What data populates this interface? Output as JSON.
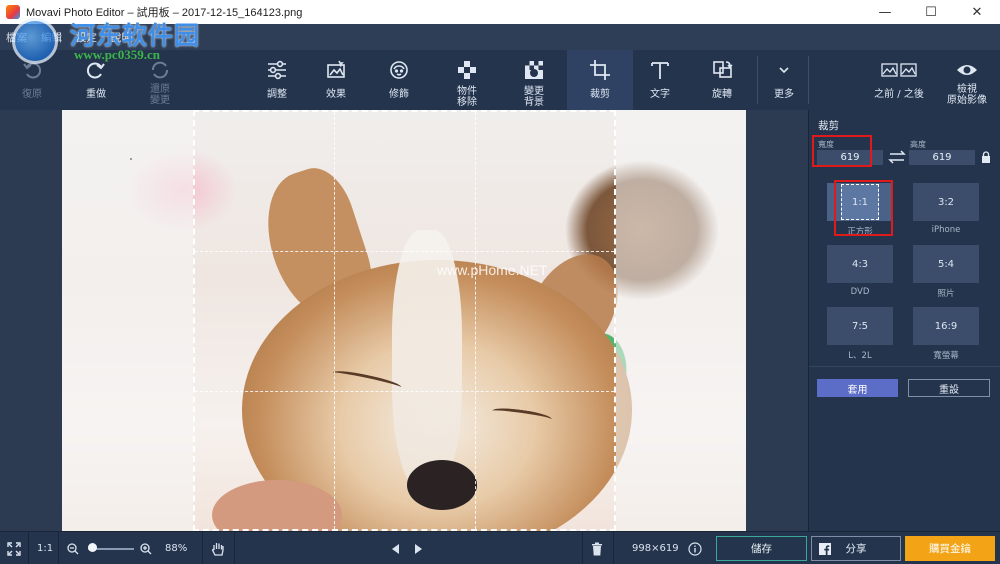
{
  "window": {
    "title": "Movavi Photo Editor – 試用板 – 2017-12-15_164123.png",
    "controls": {
      "minimize": "—",
      "maximize": "☐",
      "close": "✕"
    }
  },
  "menu": [
    "檔案",
    "編輯",
    "設定",
    "說明"
  ],
  "watermark": {
    "site": "河东软件园",
    "url": "www.pc0359.cn"
  },
  "toolbar": {
    "undo": "復原",
    "redo": "重做",
    "restore": "還原\n變更",
    "adjust": "調整",
    "effects": "效果",
    "retouch": "修飾",
    "object_removal": "物件\n移除",
    "change_background": "變更\n背景",
    "crop": "裁剪",
    "text": "文字",
    "rotate": "旋轉",
    "more": "更多",
    "before_after": "之前 / 之後",
    "view_original": "檢視\n原始影像"
  },
  "canvas": {
    "photo_watermark": "www.pHome.NET"
  },
  "crop_panel": {
    "title": "裁剪",
    "width_label": "寬度",
    "width_value": "619",
    "height_label": "高度",
    "height_value": "619",
    "ratios": [
      {
        "ratio": "1:1",
        "label": "正方形"
      },
      {
        "ratio": "3:2",
        "label": "iPhone"
      },
      {
        "ratio": "4:3",
        "label": "DVD"
      },
      {
        "ratio": "5:4",
        "label": "照片"
      },
      {
        "ratio": "7:5",
        "label": "L、2L"
      },
      {
        "ratio": "16:9",
        "label": "寬螢幕"
      }
    ],
    "selected_ratio": "1:1",
    "apply": "套用",
    "reset": "重設"
  },
  "bottom": {
    "actual_size": "1:1",
    "zoom": "88%",
    "dimensions": "998×619",
    "save": "儲存",
    "share": "分享",
    "buy": "購買金鑰"
  },
  "colors": {
    "accent_apply": "#5b6dc7",
    "buy_orange": "#f2a416",
    "highlight_red": "#e0191b",
    "panel_bg": "#24344d"
  }
}
